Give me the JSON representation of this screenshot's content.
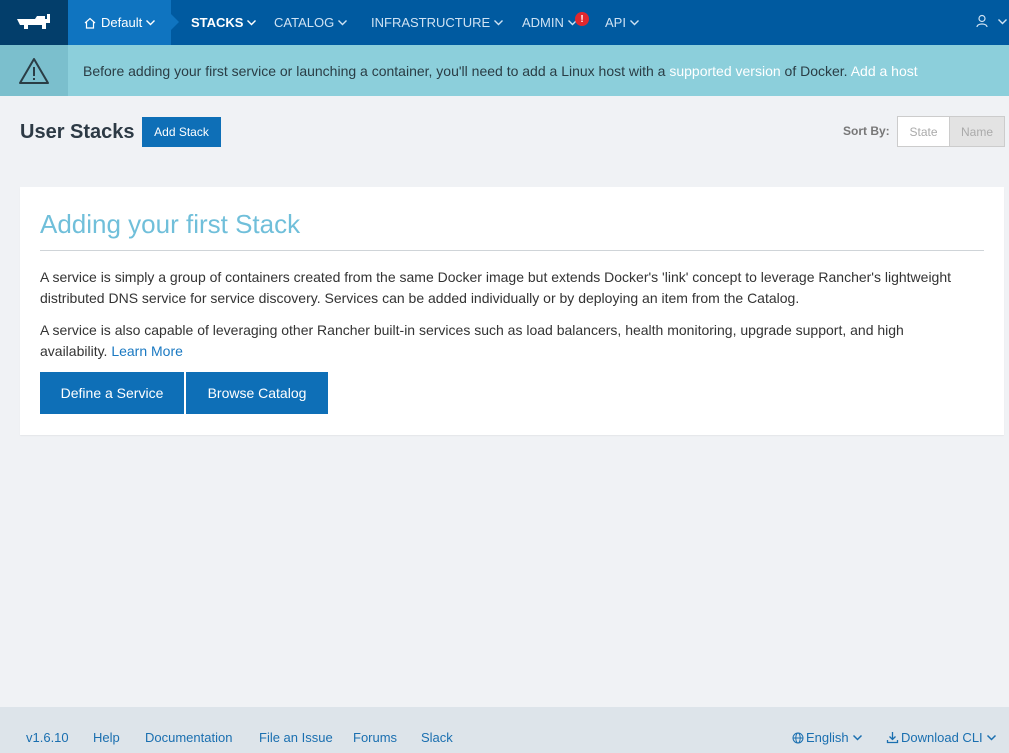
{
  "nav": {
    "environment": "Default",
    "items": [
      {
        "label": "STACKS",
        "active": true
      },
      {
        "label": "CATALOG",
        "active": false
      },
      {
        "label": "INFRASTRUCTURE",
        "active": false
      },
      {
        "label": "ADMIN",
        "active": false
      },
      {
        "label": "API",
        "active": false
      }
    ],
    "admin_badge": "!",
    "colors": {
      "bar": "#005aa0",
      "logo_bg": "#033e6b",
      "env_bg": "#0f74c0"
    }
  },
  "banner": {
    "text_before": "Before adding your first service or launching a container, you'll need to add a Linux host with a ",
    "supported_link": "supported version",
    "text_middle": " of Docker. ",
    "add_host_link": "Add a host",
    "icon": "warning-icon"
  },
  "header": {
    "title": "User Stacks",
    "add_button": "Add Stack",
    "sort_label": "Sort By:",
    "sort_options": [
      "State",
      "Name"
    ],
    "sort_selected": "Name"
  },
  "card": {
    "title": "Adding your first Stack",
    "paragraph1": "A service is simply a group of containers created from the same Docker image but extends Docker's 'link' concept to leverage Rancher's lightweight distributed DNS service for service discovery. Services can be added individually or by deploying an item from the Catalog.",
    "paragraph2": "A service is also capable of leveraging other Rancher built-in services such as load balancers, health monitoring, upgrade support, and high availability. ",
    "learn_more": "Learn More",
    "define_button": "Define a Service",
    "browse_button": "Browse Catalog"
  },
  "footer": {
    "version": "v1.6.10",
    "links": [
      "Help",
      "Documentation",
      "File an Issue",
      "Forums",
      "Slack"
    ],
    "language": "English",
    "download": "Download CLI"
  }
}
